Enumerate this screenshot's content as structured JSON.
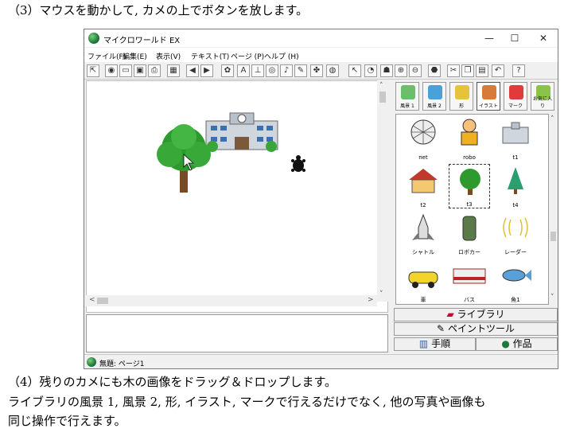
{
  "doc": {
    "step3": "（3）マウスを動かして, カメの上でボタンを放します。",
    "step4": "（4）残りのカメにも木の画像をドラッグ＆ドロップします。",
    "note_line1": "ライブラリの風景 1, 風景 2, 形, イラスト, マークで行えるだけでなく, 他の写真や画像も",
    "note_line2": "同じ操作で行えます。"
  },
  "window": {
    "title": "マイクロワールド EX",
    "controls": {
      "minimize": "—",
      "maximize": "☐",
      "close": "✕"
    }
  },
  "menu": [
    "ファイル(F)",
    "編集(E)",
    "表示(V)",
    "テキスト(T)",
    "ページ (P)",
    "ヘルプ (H)"
  ],
  "toolbar_icons": [
    "pointer-icon",
    "globe-icon",
    "open-icon",
    "save-icon",
    "print-icon",
    "grid-icon",
    "left-arrow-icon",
    "right-arrow-icon",
    "turtle-icon",
    "text-icon",
    "slider-icon",
    "eye-icon",
    "music-icon",
    "brush-icon",
    "animal-icon",
    "earth-icon",
    "arrow-cursor-icon",
    "watch-icon",
    "stamp-icon",
    "zoom-in-icon",
    "zoom-out-icon",
    "stop-icon",
    "cut-icon",
    "copy-icon",
    "paste-icon",
    "undo-icon",
    "help-icon"
  ],
  "library": {
    "tabs": [
      {
        "label": "風景 1",
        "icon": "landscape1-icon",
        "color": "#6bbf6b"
      },
      {
        "label": "風景 2",
        "icon": "landscape2-icon",
        "color": "#4aa0d8"
      },
      {
        "label": "形",
        "icon": "shape-icon",
        "color": "#e6c43a"
      },
      {
        "label": "イラスト",
        "icon": "illustration-icon",
        "color": "#d87a3a"
      },
      {
        "label": "マーク",
        "icon": "mark-icon",
        "color": "#e03a3a"
      },
      {
        "label": "お気に入り",
        "icon": "favorite-icon",
        "color": "#8bc34a"
      }
    ],
    "items": [
      {
        "label": "net",
        "icon": "net-icon"
      },
      {
        "label": "robo",
        "icon": "robot-icon"
      },
      {
        "label": "t1",
        "icon": "school-icon"
      },
      {
        "label": "t2",
        "icon": "house-icon"
      },
      {
        "label": "t3",
        "icon": "tree-icon",
        "selected": true
      },
      {
        "label": "t4",
        "icon": "pine-icon"
      },
      {
        "label": "シャトル",
        "icon": "shuttle-icon"
      },
      {
        "label": "ロボカー",
        "icon": "robocar-icon"
      },
      {
        "label": "レーダー",
        "icon": "radar-icon"
      },
      {
        "label": "車",
        "icon": "car-icon"
      },
      {
        "label": "バス",
        "icon": "bus-icon"
      },
      {
        "label": "魚1",
        "icon": "fish-icon"
      }
    ]
  },
  "panels": {
    "library": "ライブラリ",
    "paint": "ペイントツール",
    "steps": "手順",
    "work": "作品"
  },
  "status": "無題: ページ1"
}
